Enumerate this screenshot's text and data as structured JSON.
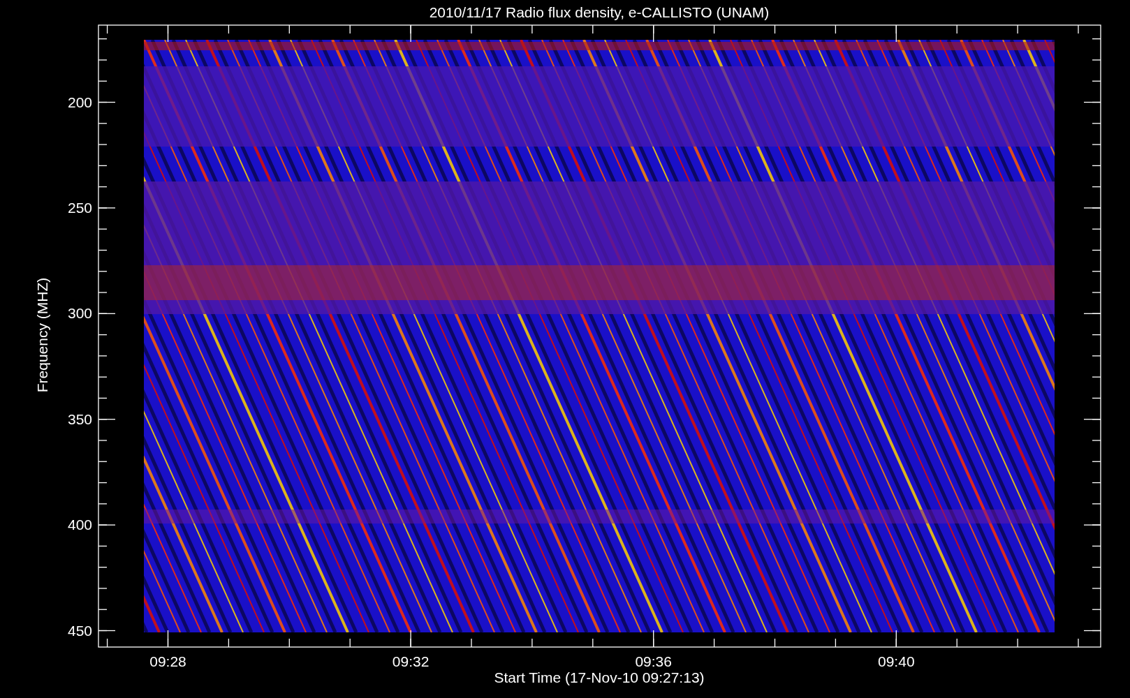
{
  "title": "2010/11/17  Radio flux density, e-CALLISTO (UNAM)",
  "ylabel": "Frequency (MHZ)",
  "xlabel": "Start Time (17-Nov-10 09:27:13)",
  "yticks": [
    "200",
    "250",
    "300",
    "350",
    "400",
    "450"
  ],
  "xticks": [
    "09:28",
    "09:32",
    "09:36",
    "09:40"
  ]
}
